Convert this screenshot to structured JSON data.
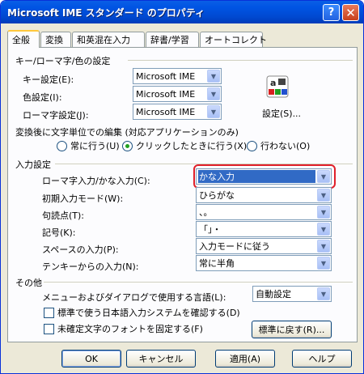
{
  "window": {
    "title": "Microsoft IME スタンダード のプロパティ"
  },
  "titlebar_buttons": {
    "help": "?",
    "close": "✕"
  },
  "tabs": [
    "全般",
    "変換",
    "和英混在入力",
    "辞書/学習",
    "オートコレクト"
  ],
  "key_group": {
    "title": "キー/ローマ字/色の設定",
    "rows": [
      {
        "label": "キー設定(E):",
        "value": "Microsoft IME"
      },
      {
        "label": "色設定(I):",
        "value": "Microsoft IME"
      },
      {
        "label": "ローマ字設定(J):",
        "value": "Microsoft IME"
      }
    ],
    "settings_button": "設定(S)..."
  },
  "edit_group": {
    "title": "変換後に文字単位での編集 (対応アプリケーションのみ)",
    "options": [
      {
        "label": "常に行う(U)",
        "selected": false
      },
      {
        "label": "クリックしたときに行う(X)",
        "selected": true
      },
      {
        "label": "行わない(O)",
        "selected": false
      }
    ]
  },
  "input_group": {
    "title": "入力設定",
    "rows": [
      {
        "label": "ローマ字入力/かな入力(C):",
        "value": "かな入力",
        "highlighted": true
      },
      {
        "label": "初期入力モード(W):",
        "value": "ひらがな"
      },
      {
        "label": "句読点(T):",
        "value": "、。"
      },
      {
        "label": "記号(K):",
        "value": "「」・"
      },
      {
        "label": "スペースの入力(P):",
        "value": "入力モードに従う"
      },
      {
        "label": "テンキーからの入力(N):",
        "value": "常に半角"
      }
    ]
  },
  "other_group": {
    "title": "その他",
    "language_label": "メニューおよびダイアログで使用する言語(L):",
    "language_value": "自動設定",
    "checkboxes": [
      {
        "label": "標準で使う日本語入力システムを確認する(D)",
        "checked": false
      },
      {
        "label": "未確定文字のフォントを固定する(F)",
        "checked": false
      }
    ],
    "reset_button": "標準に戻す(R)..."
  },
  "footer": {
    "ok": "OK",
    "cancel": "キャンセル",
    "apply": "適用(A)",
    "help": "ヘルプ"
  },
  "colors": {
    "title_bar": "#0054e3",
    "highlight_ring": "#e0202a",
    "selection": "#316ac5"
  }
}
